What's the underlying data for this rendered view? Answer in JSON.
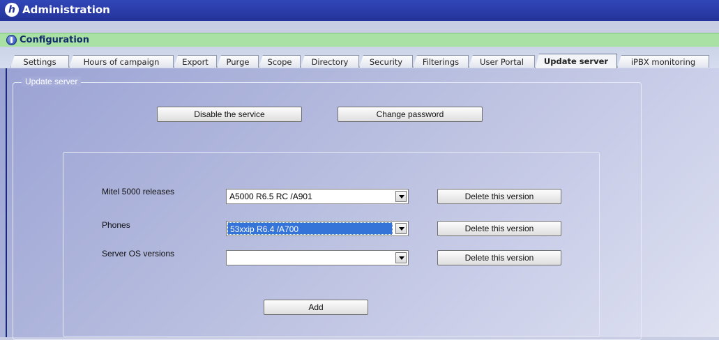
{
  "window": {
    "title": "Administration"
  },
  "section": {
    "title": "Configuration"
  },
  "tabs": [
    {
      "label": "Settings"
    },
    {
      "label": "Hours of campaign"
    },
    {
      "label": "Export"
    },
    {
      "label": "Purge"
    },
    {
      "label": "Scope"
    },
    {
      "label": "Directory"
    },
    {
      "label": "Security"
    },
    {
      "label": "Filterings"
    },
    {
      "label": "User Portal"
    },
    {
      "label": "Update server",
      "active": true
    },
    {
      "label": "iPBX monitoring"
    }
  ],
  "group": {
    "label": "Update server"
  },
  "buttons": {
    "disable": "Disable the service",
    "change_password": "Change password",
    "add": "Add"
  },
  "rows": [
    {
      "label": "Mitel 5000 releases",
      "value": "A5000 R6.5 RC /A901",
      "delete": "Delete this version"
    },
    {
      "label": "Phones",
      "value": "53xxip R6.4 /A700",
      "delete": "Delete this version"
    },
    {
      "label": "Server OS versions",
      "value": "",
      "delete": "Delete this version"
    }
  ],
  "colors": {
    "title_bar": "#24339a",
    "section_bar": "#a9e0a3",
    "selection": "#3473d8"
  },
  "icons": {
    "app": "app-logo-icon",
    "section": "info-icon",
    "dropdown": "chevron-down-icon"
  }
}
